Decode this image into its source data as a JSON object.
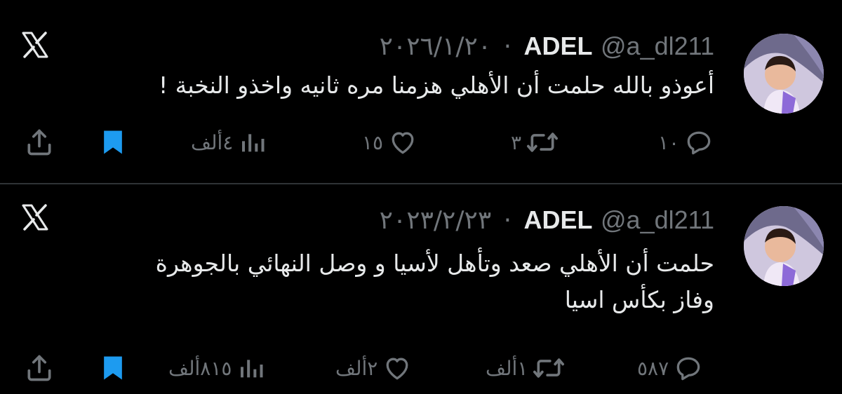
{
  "tweets": [
    {
      "name": "ADEL",
      "handle": "@a_dl211",
      "separator": "·",
      "date": "٢٠٢٦/١/٢٠",
      "text_lines": [
        "أعوذو بالله حلمت أن الأهلي هزمنا مره ثانيه واخذو النخبة !"
      ],
      "replies": "١٠",
      "reposts": "٣",
      "likes": "١٥",
      "views": "٤ألف",
      "bookmarked": true
    },
    {
      "name": "ADEL",
      "handle": "@a_dl211",
      "separator": "·",
      "date": "٢٠٢٣/٢/٢٣",
      "text_lines": [
        "حلمت أن الأهلي صعد وتأهل لأسيا و وصل النهائي بالجوهرة",
        "وفاز بكأس اسيا"
      ],
      "replies": "٥٨٧",
      "reposts": "١ألف",
      "likes": "٢ألف",
      "views": "٨١٥ألف",
      "bookmarked": true
    }
  ],
  "colors": {
    "background": "#000000",
    "text": "#e7e9ea",
    "muted": "#71767b",
    "bookmark": "#1d9bf0",
    "divider": "#2f3336"
  },
  "icons": {
    "logo": "x-logo-icon",
    "reply": "reply-icon",
    "repost": "repost-icon",
    "like": "like-icon",
    "views": "views-icon",
    "bookmark": "bookmark-icon",
    "share": "share-icon"
  }
}
